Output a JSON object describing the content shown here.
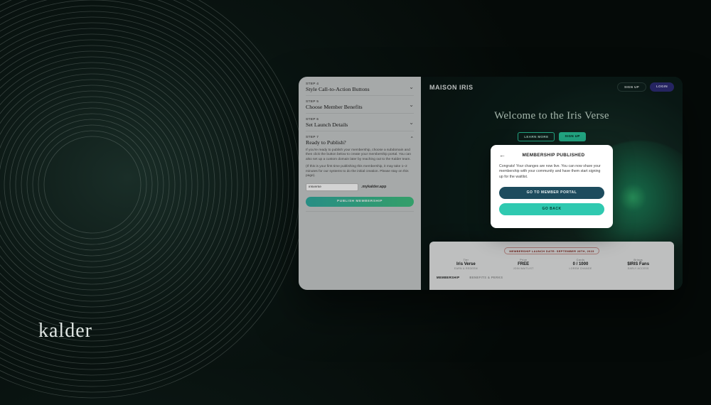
{
  "brand_mark": "kalder",
  "steps": {
    "s4": {
      "label": "STEP 4",
      "title": "Style Call-to-Action Buttons"
    },
    "s5": {
      "label": "STEP 5",
      "title": "Choose Member Benefits"
    },
    "s6": {
      "label": "STEP 6",
      "title": "Set Launch Details"
    },
    "s7": {
      "label": "STEP 7",
      "title": "Ready to Publish?",
      "desc1": "If you're ready to publish your membership, choose a subdomain and then click the button below to create your membership portal. You can also set up a custom domain later by reaching out to the Kalder team.",
      "desc2": "(If this is your first time publishing this membership, it may take 1–2 minutes for our systems to do the initial creation. Please stay on this page)."
    }
  },
  "subdomain": {
    "value": "irisverse",
    "suffix": ".mykalder.app"
  },
  "publish_btn": "PUBLISH MEMBERSHIP",
  "preview": {
    "brand": "MAISON IRIS",
    "signup": "SIGN UP",
    "login": "LOGIN",
    "headline": "Welcome to the Iris Verse",
    "cta_fill": "SIGN UP",
    "cta_ghost": "LEARN MORE",
    "launch_pill": "MEMBERSHIP LAUNCH DATE: SEPTEMBER 28TH, 2023",
    "stats": {
      "tier": {
        "label": "Tier",
        "value": "Iris Verse",
        "sub": "EARN & REDEEM"
      },
      "price": {
        "label": "Price",
        "value": "FREE",
        "sub": "JOIN WAITLIST"
      },
      "cards": {
        "label": "Cards",
        "value": "0 / 1000",
        "sub": "LOREM CHANGE"
      },
      "brings": {
        "label": "Brings",
        "value": "$IRIS Fans",
        "sub": "EARLY ACCESS"
      }
    },
    "tabs": {
      "a": "MEMBERSHIP",
      "b": "BENEFITS & PERKS"
    }
  },
  "modal": {
    "title": "MEMBERSHIP PUBLISHED",
    "body": "Congrats! Your changes are now live. You can now share your membership with your community and have them start signing up for the waitlist.",
    "primary": "GO TO MEMBER PORTAL",
    "secondary": "GO BACK"
  }
}
